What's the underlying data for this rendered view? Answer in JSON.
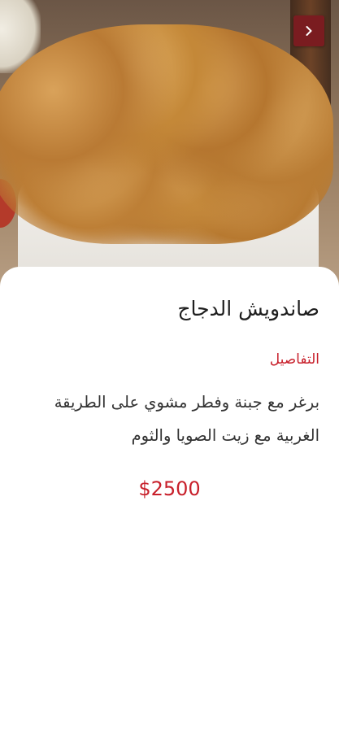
{
  "nav": {
    "forward_icon": "chevron-right-icon",
    "button_color": "#7a1c20"
  },
  "product": {
    "image": "fried-chicken-bucket-photo",
    "title": "صاندويش الدجاج",
    "details_label": "التفاصيل",
    "description": "برغر مع جبنة وفطر مشوي على الطريقة الغربية مع زيت الصويا والثوم",
    "price": "$2500"
  },
  "colors": {
    "accent": "#c8202b",
    "title_text": "#1f1f1f",
    "body_text": "#333333",
    "background": "#ffffff"
  }
}
